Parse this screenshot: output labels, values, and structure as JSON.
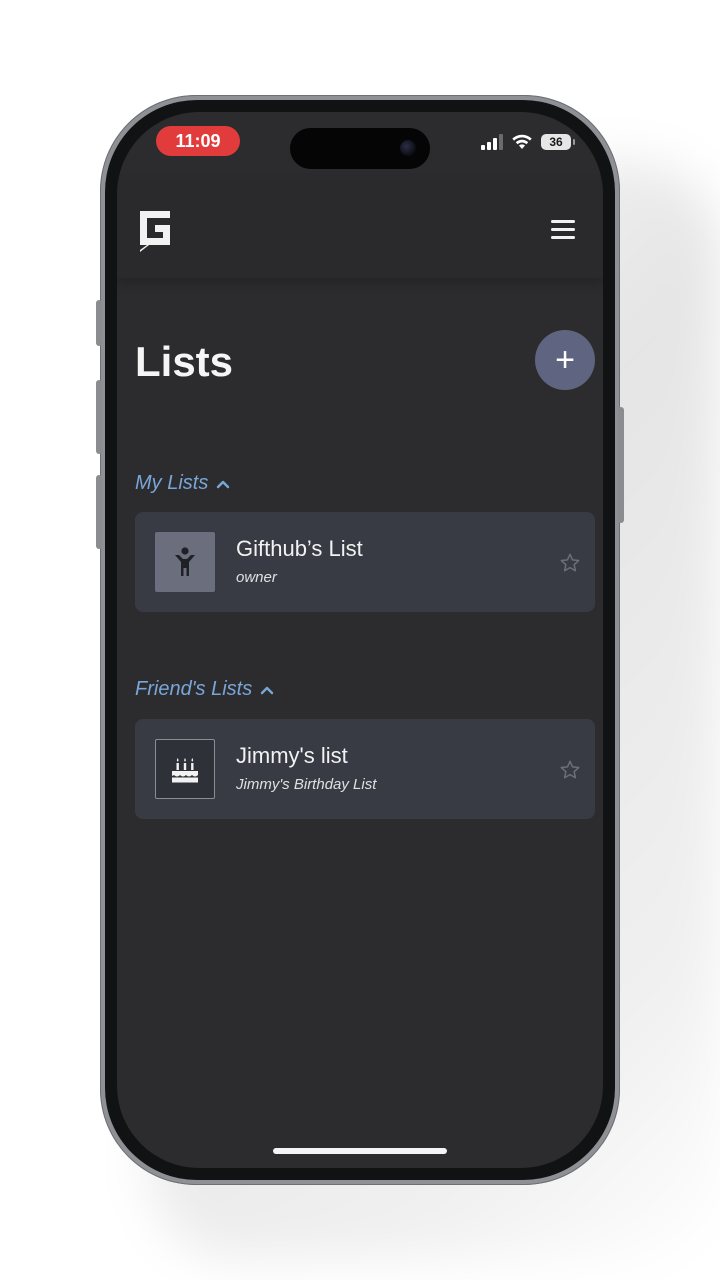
{
  "status_bar": {
    "time": "11:09",
    "battery": "36"
  },
  "header": {
    "logo_icon": "gifthub-logo-icon",
    "menu_icon": "hamburger-menu-icon"
  },
  "page": {
    "title": "Lists",
    "add_icon": "+"
  },
  "sections": [
    {
      "title": "My Lists",
      "items": [
        {
          "name": "Gifthub’s List",
          "subtitle": "owner",
          "icon": "child-icon"
        }
      ]
    },
    {
      "title": "Friend's Lists",
      "items": [
        {
          "name": "Jimmy's list",
          "subtitle": "Jimmy's Birthday List",
          "icon": "birthday-cake-icon"
        }
      ]
    }
  ],
  "colors": {
    "background": "#2c2c2e",
    "card": "#383b44",
    "accent": "#79a6d8",
    "add_button": "#5f6580",
    "time_pill": "#e23b3b"
  }
}
